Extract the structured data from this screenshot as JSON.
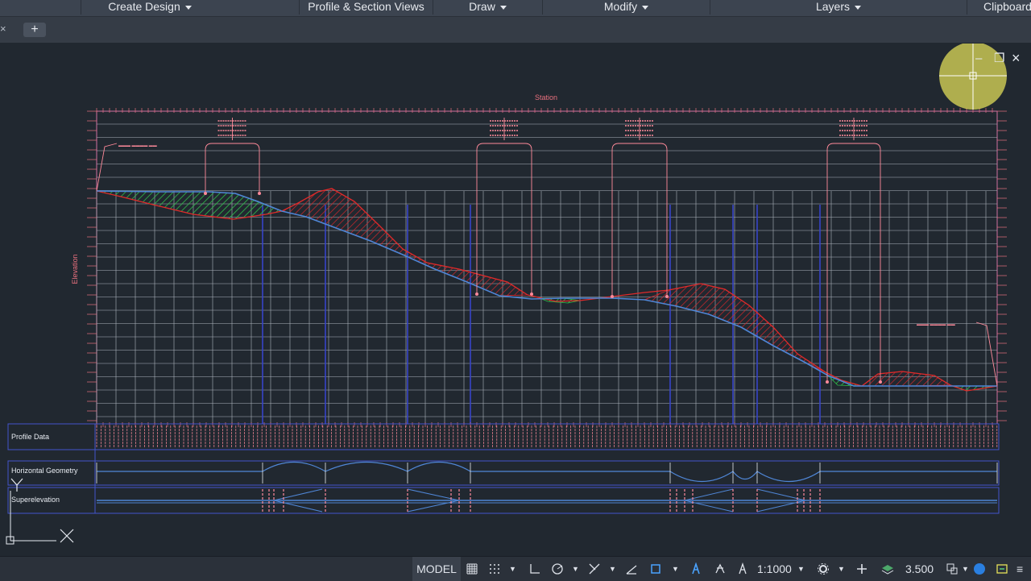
{
  "ribbon": {
    "panels": [
      {
        "label": "Create Design",
        "dropdown": true
      },
      {
        "label": "Profile & Section Views",
        "dropdown": false
      },
      {
        "label": "Draw",
        "dropdown": true
      },
      {
        "label": "Modify",
        "dropdown": true
      },
      {
        "label": "Layers",
        "dropdown": true
      },
      {
        "label": "Clipboard",
        "dropdown": false
      }
    ]
  },
  "tabs": {
    "close_glyph": "×",
    "add_glyph": "+"
  },
  "viewport": {
    "minimize": "–",
    "restore": "❐",
    "close": "×"
  },
  "profile_view": {
    "title": "Station",
    "left_axis_label": "Elevation",
    "bands": {
      "profile_data": "Profile Data",
      "horizontal_geometry": "Horizontal Geometry",
      "superelevation": "Superelevation"
    }
  },
  "statusbar": {
    "model": "MODEL",
    "scale": "1:1000",
    "lineweight": "3.500"
  },
  "colors": {
    "grid": "#aeb4bd",
    "existing_ground": "#e02a2a",
    "design_profile": "#4f86d6",
    "cut_fill_red": "#d8262b",
    "cut_fill_green": "#2ec04a",
    "pvi_leader": "#ff8a9a",
    "highlight": "#e6e25a"
  },
  "icons": [
    "grid-icon",
    "snap-icon",
    "ortho-icon",
    "polar-icon",
    "osnap-icon",
    "dynucs-icon",
    "annotation-icon",
    "workspace-gear-icon",
    "plus-icon",
    "layer-icon",
    "isolate-icon",
    "hardware-accel-icon",
    "customize-icon",
    "ucs-icon"
  ]
}
